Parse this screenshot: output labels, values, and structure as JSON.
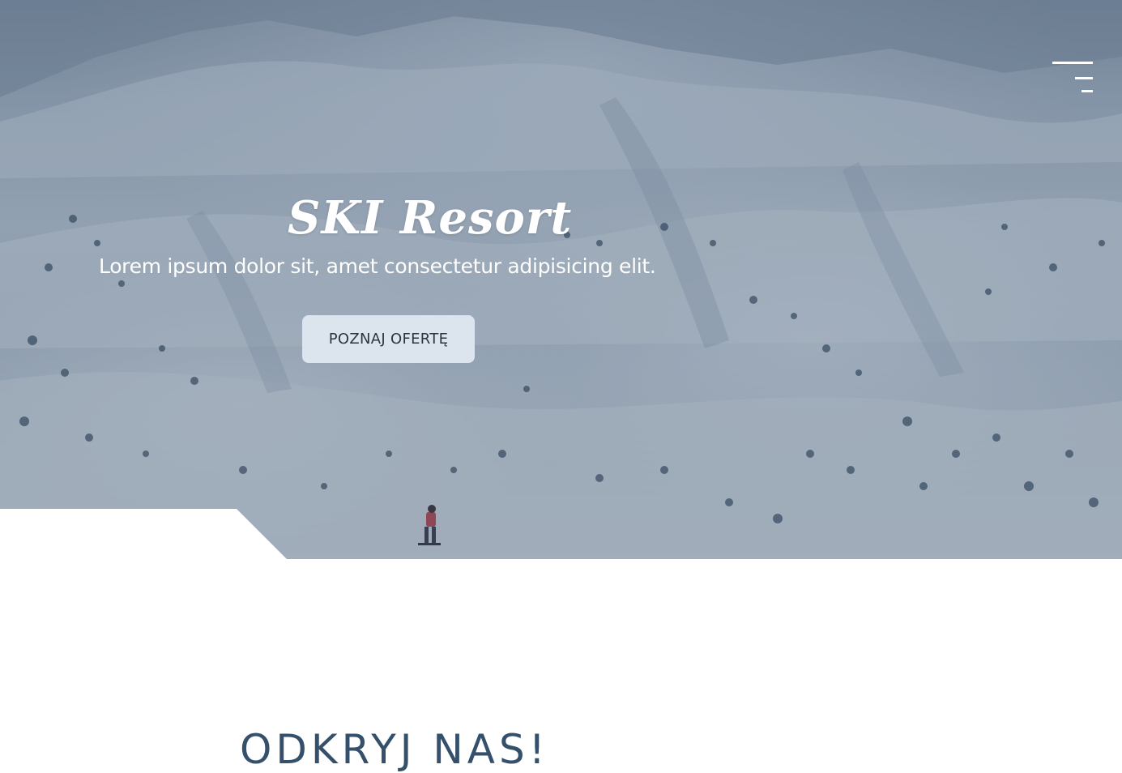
{
  "hero": {
    "title": "SKI Resort",
    "subtitle": "Lorem ipsum dolor sit, amet consectetur adipisicing elit.",
    "cta_label": "POZNAJ OFERTĘ",
    "background_image": "snowy-mountain-slope-photo",
    "overlay_color": "#374b64"
  },
  "nav": {
    "menu_icon": "hamburger-menu-icon"
  },
  "about": {
    "heading": "ODKRYJ NAS!"
  },
  "colors": {
    "cta_background": "#dce5ee",
    "cta_text": "#2b3642",
    "heading_text": "#35506a"
  }
}
